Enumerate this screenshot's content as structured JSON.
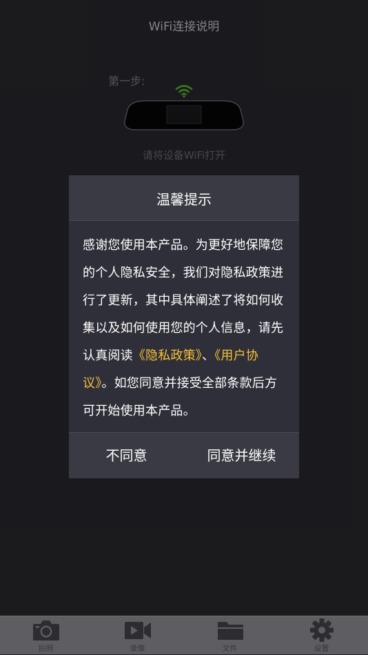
{
  "header": {
    "title": "WiFi连接说明"
  },
  "guide": {
    "step_label": "第一步:",
    "step_hint": "请将设备WiFi打开",
    "wifi_icon": "wifi-icon",
    "device_image": "dashcam-mirror-image"
  },
  "dialog": {
    "title": "温馨提示",
    "body_part1": "感谢您使用本产品。为更好地保障您的个人隐私安全，我们对隐私政策进行了更新，其中具体阐述了将如何收集以及如何使用您的个人信息，请先认真阅读",
    "privacy_link": "《隐私政策》",
    "separator": "、",
    "agreement_link": "《用户协议》",
    "body_part2": "。如您同意并接受全部条款后方可开始使用本产品。",
    "disagree_label": "不同意",
    "agree_label": "同意并继续",
    "link_color": "#f5c03b"
  },
  "tabbar": {
    "items": [
      {
        "label": "拍照",
        "icon": "camera-icon"
      },
      {
        "label": "录像",
        "icon": "video-icon"
      },
      {
        "label": "文件",
        "icon": "folder-icon"
      },
      {
        "label": "设置",
        "icon": "gear-icon"
      }
    ]
  }
}
